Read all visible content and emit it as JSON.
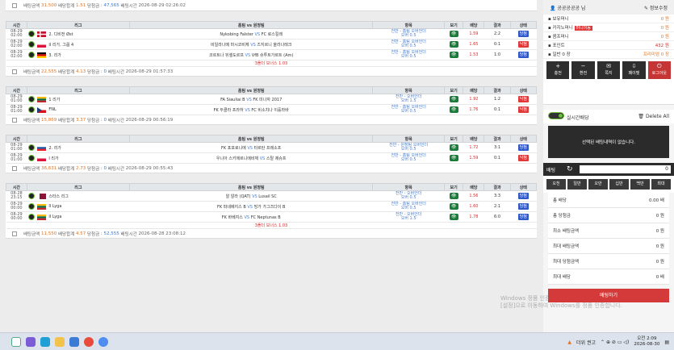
{
  "columns": [
    "시간",
    "리그",
    "홈팀 vs 원정팀",
    "항목",
    "보기",
    "배당",
    "결과",
    "상태"
  ],
  "top_summary": {
    "label_amount": "배팅금액",
    "amount": "31,500",
    "label_odds": "배당합계",
    "odds": "1.51",
    "label_win": "당첨금",
    "win": "47,565",
    "label_time": "배팅시간",
    "time": "2026-08-29 02:26:02"
  },
  "slips": [
    {
      "rows": [
        {
          "date": "08-29",
          "time": "02:00",
          "league": "2. 디비전 Øst",
          "flag": "denmark",
          "home": "Nykobing Falster",
          "vs": "VS",
          "away": "FC 로스킬레",
          "market1": "전반 - 홈팀 오버언더",
          "market2": "오버 0.5",
          "view": "👁",
          "odds": "1.59",
          "score": "2:2",
          "status": "당첨",
          "status_type": "win"
        },
        {
          "date": "08-29",
          "time": "02:00",
          "league": "II 리가, 그룹 4",
          "flag": "poland",
          "home": "비일라나메 마시코비체",
          "vs": "VS",
          "away": "즈지르니 올라나레크",
          "market1": "전반 - 홈팀 오버언더",
          "market2": "오버 0.5",
          "view": "👁",
          "odds": "1.65",
          "score": "0:1",
          "status": "낙첨",
          "status_type": "lose"
        },
        {
          "date": "08-29",
          "time": "02:00",
          "league": "3. 리가",
          "flag": "germany",
          "home": "코르트나 뒤셀도르프",
          "vs": "VS",
          "away": "VfB 슈투트가르트 (Am)",
          "market1": "전반 - 홈팀 오버언더",
          "market2": "오버 0.5",
          "view": "👁",
          "odds": "1.53",
          "score": "1:0",
          "status": "당첨",
          "status_type": "win"
        }
      ],
      "bonus": "3폴더 보너스 1.03",
      "summary": {
        "amount": "22,555",
        "odds": "4.13",
        "win": "0",
        "time": "2026-08-29 01:57:33"
      }
    },
    {
      "rows": [
        {
          "date": "08-29",
          "time": "01:00",
          "league": "1 리가",
          "flag": "lithuania",
          "home": "FA Siauliai B",
          "vs": "VS",
          "away": "FK 미나자 2017",
          "market1": "전반 - 오버언더",
          "market2": "오버 1.5",
          "view": "👁",
          "odds": "1.92",
          "score": "1:2",
          "status": "낙첨",
          "status_type": "lose"
        },
        {
          "date": "08-29",
          "time": "01:00",
          "league": "FNL",
          "flag": "czech",
          "home": "FK 두클라 프라하",
          "vs": "VS",
          "away": "FC 비소치나 이흘라바",
          "market1": "전반 - 홈팀 오버언더",
          "market2": "오버 0.5",
          "view": "👁",
          "odds": "1.76",
          "score": "0:1",
          "status": "낙첨",
          "status_type": "lose"
        }
      ],
      "bonus": "",
      "summary": {
        "amount": "15,869",
        "odds": "3.37",
        "win": "0",
        "time": "2026-08-29 00:56:19"
      }
    },
    {
      "rows": [
        {
          "date": "08-29",
          "time": "01:00",
          "league": "2. 리가",
          "flag": "slovakia",
          "home": "FK 포포로니에",
          "vs": "VS",
          "away": "타르탄 프레소프",
          "market1": "전반 - 원정팀 오버언더",
          "market2": "오버 0.5",
          "view": "👁",
          "odds": "1.72",
          "score": "3:1",
          "status": "당첨",
          "status_type": "win"
        },
        {
          "date": "08-29",
          "time": "01:00",
          "league": "I 리가",
          "flag": "poland",
          "home": "우니아 스키에르니에비체",
          "vs": "VS",
          "away": "스탈 제슈프",
          "market1": "전반 - 홈팀 오버언더",
          "market2": "오버 0.5",
          "view": "👁",
          "odds": "1.59",
          "score": "0:1",
          "status": "낙첨",
          "status_type": "lose"
        }
      ],
      "bonus": "",
      "summary": {
        "amount": "36,631",
        "odds": "2.73",
        "win": "0",
        "time": "2026-08-29 00:55:43"
      }
    },
    {
      "rows": [
        {
          "date": "08-28",
          "time": "23:15",
          "league": "스타스 리그",
          "flag": "qatar",
          "home": "알 알라 (QAT)",
          "vs": "VS",
          "away": "Lusail SC",
          "market1": "전반 - 오버언더",
          "market2": "오버 0.5",
          "view": "👁",
          "odds": "1.56",
          "score": "3:3",
          "status": "당첨",
          "status_type": "win"
        },
        {
          "date": "08-29",
          "time": "00:00",
          "league": "II Lyga",
          "flag": "lithuania",
          "home": "FK 파네베지스 B",
          "vs": "VS",
          "away": "빙가 가그즈다이 B",
          "market1": "전반 - 홈팀 오버언더",
          "market2": "오버 0.5",
          "view": "👁",
          "odds": "1.60",
          "score": "2:1",
          "status": "당첨",
          "status_type": "win"
        },
        {
          "date": "08-29",
          "time": "00:00",
          "league": "II Lyga",
          "flag": "lithuania",
          "home": "FK 바베지스",
          "vs": "VS",
          "away": "FC Neptunas B",
          "market1": "전반 - 오버언더",
          "market2": "오버 1.5",
          "view": "👁",
          "odds": "1.78",
          "score": "6:0",
          "status": "당첨",
          "status_type": "win"
        }
      ],
      "bonus": "3폴더 보너스 1.03",
      "summary": {
        "amount": "11,550",
        "odds": "4.57",
        "win": "52,555",
        "time": "2026-08-28 23:08:12"
      }
    }
  ],
  "sidebar": {
    "username": "공공공공공 님",
    "edit_label": "정보수정",
    "rows": [
      {
        "label": "보유머니",
        "value": "0 원"
      },
      {
        "label": "카지노머니",
        "tag": "머니이동",
        "value": "0 원"
      },
      {
        "label": "콤프머니",
        "value": "0 원"
      },
      {
        "label": "포인트",
        "value": "432 원"
      },
      {
        "label": "일반 0 장",
        "value": "프리미엄 0 장"
      }
    ],
    "buttons": [
      "충전",
      "환전",
      "쪽지",
      "페이벳",
      "로그아웃"
    ],
    "button_icons": [
      "+",
      "−",
      "✉",
      "⇩",
      "⏻"
    ],
    "live_label": "실시간배당",
    "delete_all": "Delete All",
    "empty_msg": "선택된 배팅내역이 없습니다.",
    "bet_label": "배팅",
    "bet_amount": "0",
    "quick": [
      "오천",
      "일만",
      "오만",
      "십만",
      "백만",
      "최대"
    ],
    "sums": [
      {
        "label": "총 배당",
        "value": "0.00 배"
      },
      {
        "label": "총 당첨금",
        "value": "0 원"
      },
      {
        "label": "최소 배팅금액",
        "value": "0 원"
      },
      {
        "label": "최대 배팅금액",
        "value": "0 원"
      },
      {
        "label": "최대 당첨금액",
        "value": "0 원"
      },
      {
        "label": "최대 배당",
        "value": "0 배"
      }
    ],
    "bet_button": "배팅하기"
  },
  "labels": {
    "amount": "배팅금액",
    "odds": "배당합계",
    "win": "당첨금",
    "time": "배팅시간"
  },
  "watermark": {
    "line1": "Windows 정품 인증",
    "line2": "[설정]으로 이동하여 Windows를 정품 인증합니다."
  },
  "taskbar": {
    "weather": "더위 권고",
    "time": "오전 2:09",
    "date": "2026-08-30"
  }
}
